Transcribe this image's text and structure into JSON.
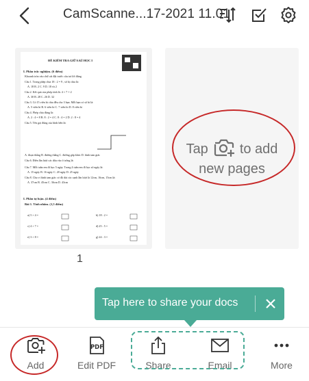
{
  "header": {
    "title": "CamScanne...17-2021 11.01",
    "icons": [
      "back-chevron-icon",
      "sort-order-icon",
      "select-check-icon",
      "gear-icon"
    ]
  },
  "pages": [
    {
      "number": "1",
      "doc_lines": [
        "ĐỀ KIỂM TRA GIỮA KÌ HỌC I",
        "I. Phần trắc nghiệm. (6 điểm)",
        "Khoanh tròn vào chữ cái đặt trước câu trả lời đúng",
        "Câu 1. Trong phép chia  18 : 2 = 9  , số bị chia là:",
        "A. 18        B. 2        C. 9        D. 18 và 2",
        "Câu 2. Kết quả của phép tính là:   4 × 7 = 2",
        "A. 30        B. 28        C. 26        D. 32",
        "Câu 3. Có 15 viên bi chia đều cho 3 bạn. Mỗi bạn có số bi là:",
        "A. 5 viên bi    B. 6 viên bi    C. 7 viên bi    D. 8 viên bi",
        "Câu 4. Phép chia đúng là:",
        "A. 2 : 4 = 8   B. 8 : 2 = 4   C. 8 : 4 = 2   D. 2 : 8 = 4",
        "Câu 5. Tên gọi đúng của hình bên là:",
        "A. đoạn thẳng   B. đường thẳng   C. đường gấp khúc   D. hình tam giác",
        "Câu 6. Điền lần lượt các dấu vào ô trống là:",
        "Câu 7. Mỗi tuần em đi học 5 ngày. Trong 4 tuần em đi học số ngày là:",
        "A. 15 ngày      B. 16 ngày      C. 20 ngày      D. 25 ngày",
        "Câu 8. Chu vi hình tam giác có độ dài các cạnh lần lượt là 12cm, 16cm, 15cm là:",
        "A. 37cm      B. 45cm      C. 36cm      D. 43cm",
        "I. Phần tự luận. (4 điểm)",
        "Bài 1. Tính nhẩm. (1,5 điểm)",
        "a) 5 × 4 =",
        "b) 18 : 2 =",
        "c) 4 × 7 =",
        "d) 25 : 5 =",
        "e) 3 × 8 =",
        "g) 24 : 3 ="
      ]
    }
  ],
  "add_page": {
    "hint_before_icon": "Tap",
    "hint_after_icon": "to add",
    "hint_line2": "new pages",
    "icon": "camera-plus-icon"
  },
  "share_tip": {
    "text": "Tap here to share your docs",
    "close_icon": "close-icon",
    "background": "#4aab96"
  },
  "toolbar": {
    "items": [
      {
        "label": "Add",
        "icon": "camera-plus-icon"
      },
      {
        "label": "Edit PDF",
        "icon": "pdf-icon"
      },
      {
        "label": "Share",
        "icon": "share-icon"
      },
      {
        "label": "Email",
        "icon": "envelope-icon"
      },
      {
        "label": "More",
        "icon": "more-dots-icon"
      }
    ]
  },
  "annotations": {
    "circle_color": "#c62828",
    "dash_color": "#4aab96"
  }
}
